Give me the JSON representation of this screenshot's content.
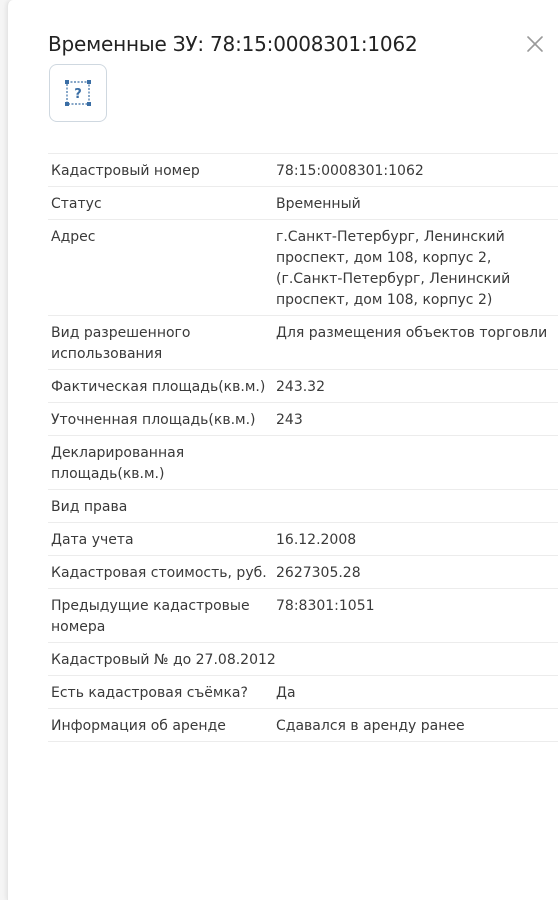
{
  "header": {
    "title": "Временные ЗУ: 78:15:0008301:1062",
    "close_icon": "close-icon",
    "type_icon": "land-plot-unknown-icon",
    "type_icon_text": "?"
  },
  "colors": {
    "icon_blue": "#3a6ea5",
    "border": "#ececec"
  },
  "properties": [
    {
      "label": "Кадастровый номер",
      "value": "78:15:0008301:1062"
    },
    {
      "label": "Статус",
      "value": "Временный"
    },
    {
      "label": "Адрес",
      "value": "г.Санкт-Петербург, Ленинский проспект, дом 108, корпус 2, (г.Санкт-Петербург, Ленинский проспект, дом 108, корпус 2)"
    },
    {
      "label": "Вид разрешенного использования",
      "value": "Для размещения объектов торговли"
    },
    {
      "label": "Фактическая площадь(кв.м.)",
      "value": "243.32"
    },
    {
      "label": "Уточненная площадь(кв.м.)",
      "value": "243"
    },
    {
      "label": "Декларированная площадь(кв.м.)",
      "value": ""
    },
    {
      "label": "Вид права",
      "value": ""
    },
    {
      "label": "Дата учета",
      "value": "16.12.2008"
    },
    {
      "label": "Кадастровая стоимость, руб.",
      "value": "2627305.28"
    },
    {
      "label": "Предыдущие кадастровые номера",
      "value": "78:8301:1051"
    },
    {
      "label": "Кадастровый № до 27.08.2012",
      "value": ""
    },
    {
      "label": "Есть кадастровая съёмка?",
      "value": "Да"
    },
    {
      "label": "Информация об аренде",
      "value": "Сдавался в аренду ранее"
    }
  ]
}
